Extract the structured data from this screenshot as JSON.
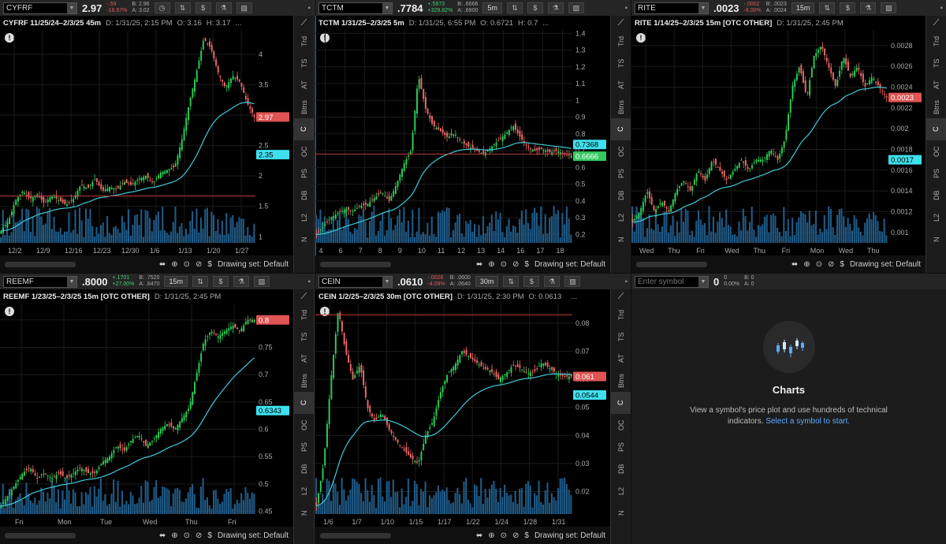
{
  "panes": [
    {
      "symbol": "CYFRF",
      "price": "2.97",
      "change": "-.59",
      "change_pct": "-16.57%",
      "bid": "B: 2.96",
      "ask": "A: 3.02",
      "timeframe": "",
      "title": "CYFRF 11/25/24–2/3/25 45m",
      "date": "D: 1/31/25, 2:15 PM",
      "open": "O: 3.16",
      "high": "H: 3.17",
      "more": "...",
      "y_ticks": [
        "4",
        "3.5",
        "3",
        "2.5",
        "2",
        "1.5",
        "1"
      ],
      "x_ticks": [
        "12/2",
        "12/9",
        "12/16",
        "12/23",
        "12/30",
        "1/6",
        "1/13",
        "1/20",
        "1/27"
      ],
      "last_label": "2.97",
      "ma_label": "2.35",
      "ylim": [
        0.9,
        4.4
      ],
      "last_val": 2.97,
      "ma_val": 2.35,
      "hline": 1.67,
      "series": [
        1.1,
        1.25,
        1.6,
        1.75,
        1.62,
        1.7,
        1.55,
        1.68,
        1.6,
        1.52,
        1.62,
        1.85,
        1.8,
        1.95,
        1.75,
        1.82,
        1.78,
        1.9,
        1.85,
        1.95,
        2.0,
        1.88,
        2.05,
        2.1,
        2.15,
        2.6,
        3.2,
        3.7,
        4.25,
        4.1,
        3.7,
        3.45,
        3.65,
        3.55,
        3.2,
        2.97
      ]
    },
    {
      "symbol": "TCTM",
      "price": ".7784",
      "change": "+.5973",
      "change_pct": "+329.82%",
      "bid": "B: .6666",
      "ask": "A: .6900",
      "timeframe": "5m",
      "title": "TCTM 1/31/25–2/3/25 5m",
      "date": "D: 1/31/25, 6:55 PM",
      "open": "O: 0.6721",
      "high": "H: 0.7",
      "more": "...",
      "y_ticks": [
        "1.4",
        "1.3",
        "1.2",
        "1.1",
        "1",
        "0.9",
        "0.8",
        "0.7",
        "0.6",
        "0.5",
        "0.4",
        "0.3",
        "0.2"
      ],
      "x_ticks": [
        "4",
        "6",
        "7",
        "8",
        "9",
        "10",
        "11",
        "12",
        "13",
        "14",
        "16",
        "17",
        "18"
      ],
      "last_label": "0.6666",
      "ma_label": "0.7368",
      "ylim": [
        0.15,
        1.42
      ],
      "last_val": 0.6666,
      "ma_val": 0.7368,
      "hline": 0.68,
      "series": [
        0.2,
        0.25,
        0.3,
        0.33,
        0.35,
        0.34,
        0.37,
        0.38,
        0.42,
        0.45,
        0.4,
        0.5,
        0.62,
        0.7,
        1.15,
        0.95,
        0.85,
        0.82,
        0.78,
        0.8,
        0.75,
        0.72,
        0.7,
        0.68,
        0.72,
        0.76,
        0.8,
        0.85,
        0.78,
        0.72,
        0.7,
        0.71,
        0.69,
        0.7,
        0.68,
        0.67
      ]
    },
    {
      "symbol": "RITE",
      "price": ".0023",
      "change": "-.0002",
      "change_pct": "-8.00%",
      "bid": "B: .0023",
      "ask": "A: .0024",
      "timeframe": "15m",
      "title": "RITE 1/14/25–2/3/25 15m [OTC OTHER]",
      "date": "D: 1/31/25, 2:45 PM",
      "open": "",
      "high": "",
      "more": "",
      "y_ticks": [
        "0.0028",
        "0.0026",
        "0.0024",
        "0.0022",
        "0.002",
        "0.0018",
        "0.0016",
        "0.0014",
        "0.0012",
        "0.001"
      ],
      "x_ticks": [
        "Wed",
        "Thu",
        "Fri",
        "Wed",
        "Thu",
        "Fri",
        "Mon",
        "Wed",
        "Thu"
      ],
      "last_label": "0.0023",
      "ma_label": "0.0017",
      "ylim": [
        0.0009,
        0.00295
      ],
      "last_val": 0.0023,
      "ma_val": 0.0017,
      "hline": null,
      "series": [
        0.0011,
        0.0012,
        0.0014,
        0.0012,
        0.0013,
        0.0012,
        0.0014,
        0.0015,
        0.0014,
        0.0016,
        0.0015,
        0.0017,
        0.0016,
        0.0015,
        0.0016,
        0.0017,
        0.0016,
        0.0017,
        0.0017,
        0.0018,
        0.0017,
        0.0019,
        0.0024,
        0.0026,
        0.0023,
        0.0027,
        0.0028,
        0.0026,
        0.0024,
        0.0027,
        0.0025,
        0.0026,
        0.0024,
        0.0025,
        0.0024,
        0.0023
      ]
    },
    {
      "symbol": "REEMF",
      "price": ".8000",
      "change": "+.1701",
      "change_pct": "+27.00%",
      "bid": "B: .7520",
      "ask": "A: .8470",
      "timeframe": "15m",
      "title": "REEMF 1/23/25–2/3/25 15m [OTC OTHER]",
      "date": "D: 1/31/25, 2:45 PM",
      "open": "",
      "high": "",
      "more": "",
      "y_ticks": [
        "0.8",
        "0.75",
        "0.7",
        "0.65",
        "0.6",
        "0.55",
        "0.5",
        "0.45"
      ],
      "x_ticks": [
        "Fri",
        "Mon",
        "Tue",
        "Wed",
        "Thu",
        "Fri"
      ],
      "last_label": "0.8",
      "ma_label": "0.6343",
      "ylim": [
        0.445,
        0.83
      ],
      "last_val": 0.8,
      "ma_val": 0.6343,
      "hline": null,
      "series": [
        0.46,
        0.48,
        0.5,
        0.52,
        0.53,
        0.51,
        0.52,
        0.51,
        0.52,
        0.51,
        0.52,
        0.53,
        0.52,
        0.52,
        0.54,
        0.55,
        0.57,
        0.56,
        0.58,
        0.59,
        0.57,
        0.58,
        0.6,
        0.61,
        0.6,
        0.62,
        0.64,
        0.7,
        0.76,
        0.78,
        0.77,
        0.78,
        0.79,
        0.78,
        0.8,
        0.8
      ]
    },
    {
      "symbol": "CEIN",
      "price": ".0610",
      "change": "-.0026",
      "change_pct": "-4.09%",
      "bid": "B: .0600",
      "ask": "A: .0640",
      "timeframe": "30m",
      "title": "CEIN 1/2/25–2/3/25 30m [OTC OTHER]",
      "date": "D: 1/31/25, 2:30 PM",
      "open": "O: 0.0613",
      "high": "",
      "more": "...",
      "y_ticks": [
        "0.08",
        "0.07",
        "0.06",
        "0.05",
        "0.04",
        "0.03",
        "0.02"
      ],
      "x_ticks": [
        "1/6",
        "1/7",
        "1/10",
        "1/15",
        "1/17",
        "1/22",
        "1/24",
        "1/28",
        "1/31"
      ],
      "last_label": "0.061",
      "ma_label": "0.0544",
      "ylim": [
        0.012,
        0.087
      ],
      "last_val": 0.061,
      "ma_val": 0.0544,
      "hline": 0.083,
      "series": [
        0.015,
        0.03,
        0.06,
        0.085,
        0.07,
        0.06,
        0.065,
        0.05,
        0.045,
        0.048,
        0.042,
        0.038,
        0.035,
        0.032,
        0.03,
        0.04,
        0.045,
        0.055,
        0.062,
        0.065,
        0.07,
        0.068,
        0.066,
        0.064,
        0.063,
        0.06,
        0.062,
        0.065,
        0.064,
        0.062,
        0.063,
        0.066,
        0.064,
        0.062,
        0.061,
        0.061
      ]
    }
  ],
  "empty_pane": {
    "placeholder": "Enter symbol",
    "price": "0",
    "change": "0",
    "change_pct": "0.00%",
    "bid": "B: 0",
    "ask": "A: 0",
    "heading": "Charts",
    "desc": "View a symbol's price plot and use hundreds of technical indicators.",
    "link": "Select a symbol to start."
  },
  "side_tabs": [
    "Trd",
    "TS",
    "AT",
    "Btns",
    "C",
    "OC",
    "PS",
    "DB",
    "L2",
    "N"
  ],
  "footer": {
    "drawing_set": "Drawing set: Default"
  },
  "colors": {
    "up": "#2ed158",
    "down": "#f26b6b",
    "ma": "#3fc9d8",
    "volume": "#1f5a86",
    "hline": "#c23a3a"
  }
}
